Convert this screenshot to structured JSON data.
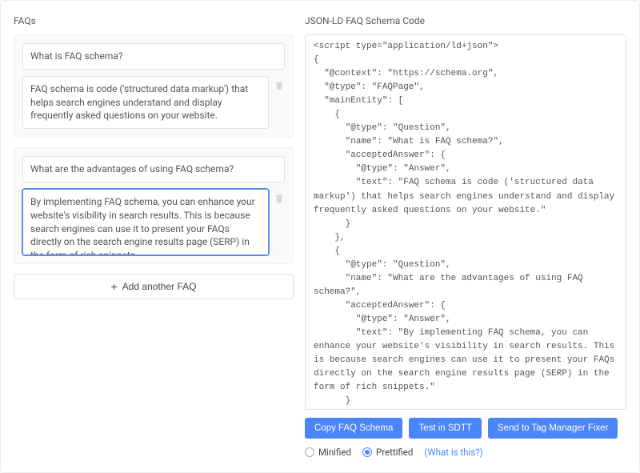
{
  "left": {
    "title": "FAQs",
    "faqs": [
      {
        "question": "What is FAQ schema?",
        "answer": "FAQ schema is code ('structured data markup') that helps search engines understand and display frequently asked questions on your website."
      },
      {
        "question": "What are the advantages of using FAQ schema?",
        "answer": "By implementing FAQ schema, you can enhance your website's visibility in search results. This is because search engines can use it to present your FAQs directly on the search engine results page (SERP) in the form of rich snippets."
      }
    ],
    "add_label": "Add another FAQ"
  },
  "right": {
    "title": "JSON-LD FAQ Schema Code",
    "code": "<script type=\"application/ld+json\">\n{\n  \"@context\": \"https://schema.org\",\n  \"@type\": \"FAQPage\",\n  \"mainEntity\": [\n    {\n      \"@type\": \"Question\",\n      \"name\": \"What is FAQ schema?\",\n      \"acceptedAnswer\": {\n        \"@type\": \"Answer\",\n        \"text\": \"FAQ schema is code ('structured data markup') that helps search engines understand and display frequently asked questions on your website.\"\n      }\n    },\n    {\n      \"@type\": \"Question\",\n      \"name\": \"What are the advantages of using FAQ schema?\",\n      \"acceptedAnswer\": {\n        \"@type\": \"Answer\",\n        \"text\": \"By implementing FAQ schema, you can enhance your website's visibility in search results. This is because search engines can use it to present your FAQs directly on the search engine results page (SERP) in the form of rich snippets.\"\n      }\n    }\n  ]\n}\n</script>\n<!--FAQPage Code Generated by https://saijogeorge.com/json-ld-schema-generator/faq/-->",
    "buttons": {
      "copy": "Copy FAQ Schema",
      "test": "Test in SDTT",
      "send": "Send to Tag Manager Fixer"
    },
    "format": {
      "minified": "Minified",
      "prettified": "Prettified",
      "what_is_this": "(What is this?)",
      "selected": "prettified"
    }
  }
}
